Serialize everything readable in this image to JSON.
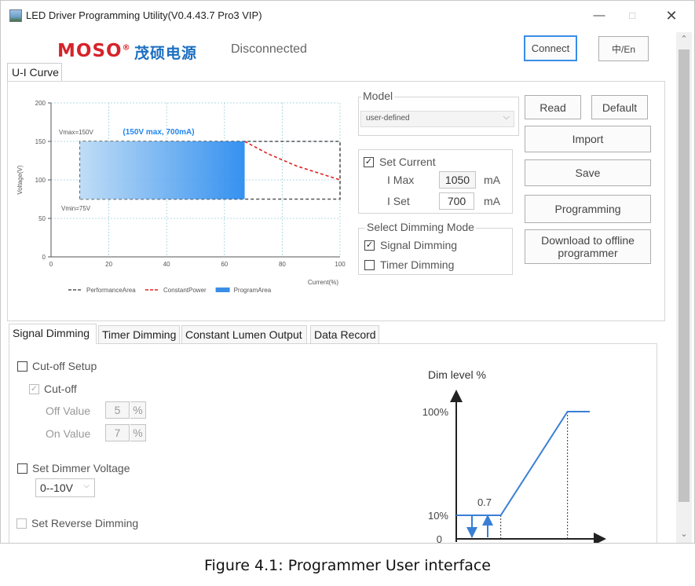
{
  "window": {
    "title": "LED Driver Programming Utility(V0.4.43.7 Pro3 VIP)",
    "controls": {
      "minimize": "—",
      "maximize": "□",
      "close": "✕"
    }
  },
  "header": {
    "logo_text": "MOSO",
    "logo_registered": "®",
    "logo_cn": "茂硕电源",
    "status": "Disconnected",
    "connect_label": "Connect",
    "lang_label": "中/En"
  },
  "ui_curve": {
    "tab_label": "U-I Curve",
    "chart_data": {
      "type": "area",
      "title": "(150V max, 700mA)",
      "xlabel": "Current(%)",
      "ylabel": "Voltage(V)",
      "xlim": [
        0,
        100
      ],
      "ylim": [
        0,
        200
      ],
      "x_ticks": [
        "0",
        "20",
        "40",
        "60",
        "80",
        "100"
      ],
      "y_ticks": [
        "0",
        "50",
        "100",
        "150",
        "200"
      ],
      "annotations": {
        "vmax": "Vmax=150V",
        "vmin": "Vmin=75V"
      },
      "grid": true,
      "legend_position": "bottom",
      "series": [
        {
          "name": "PerformanceArea",
          "style": "dashed",
          "color": "#555555",
          "x": [
            10,
            10,
            100,
            100,
            10
          ],
          "y": [
            75,
            150,
            150,
            75,
            75
          ]
        },
        {
          "name": "ConstantPower",
          "style": "dashed",
          "color": "#e02020",
          "x": [
            67,
            75,
            85,
            100
          ],
          "y": [
            150,
            134,
            118,
            100
          ]
        },
        {
          "name": "ProgramArea",
          "style": "fill",
          "color": "#3a8ee6",
          "x": [
            10,
            67
          ],
          "y": [
            75,
            150
          ]
        }
      ]
    },
    "model": {
      "label": "Model",
      "selected": "user-defined",
      "chevron": "⌵"
    },
    "set_current": {
      "checkbox_label": "Set Current",
      "checked": true,
      "imax_label": "I Max",
      "imax_value": "1050",
      "imax_unit": "mA",
      "iset_label": "I Set",
      "iset_value": "700",
      "iset_unit": "mA"
    },
    "dimming_mode": {
      "label": "Select Dimming Mode",
      "signal_label": "Signal Dimming",
      "signal_checked": true,
      "timer_label": "Timer Dimming",
      "timer_checked": false
    },
    "buttons": {
      "read": "Read",
      "default": "Default",
      "import": "Import",
      "save": "Save",
      "programming": "Programming",
      "download_line1": "Download to offline",
      "download_line2": "programmer"
    }
  },
  "bottom_tabs": [
    "Signal Dimming",
    "Timer Dimming",
    "Constant Lumen Output",
    "Data Record"
  ],
  "signal_dimming": {
    "cutoff_setup_label": "Cut-off Setup",
    "cutoff_label": "Cut-off",
    "off_value_label": "Off Value",
    "off_value": "5",
    "on_value_label": "On Value",
    "on_value": "7",
    "percent": "%",
    "set_dimmer_voltage_label": "Set Dimmer Voltage",
    "dimmer_voltage_selected": "0--10V",
    "set_reverse_label": "Set Reverse Dimming",
    "check_mark": "✓"
  },
  "dim_chart": {
    "chart_data": {
      "type": "line",
      "ylabel": "Dim level %",
      "y_ticks": [
        "100%",
        "10%",
        "0"
      ],
      "annotations": {
        "threshold": "0.7"
      },
      "x": [
        0,
        0.7,
        3,
        7.5,
        9
      ],
      "y": [
        10,
        10,
        10,
        100,
        100
      ],
      "color": "#3a7fd6"
    }
  },
  "caption": "Figure 4.1: Programmer User interface",
  "scroll": {
    "up": "⌃",
    "down": "⌄"
  }
}
